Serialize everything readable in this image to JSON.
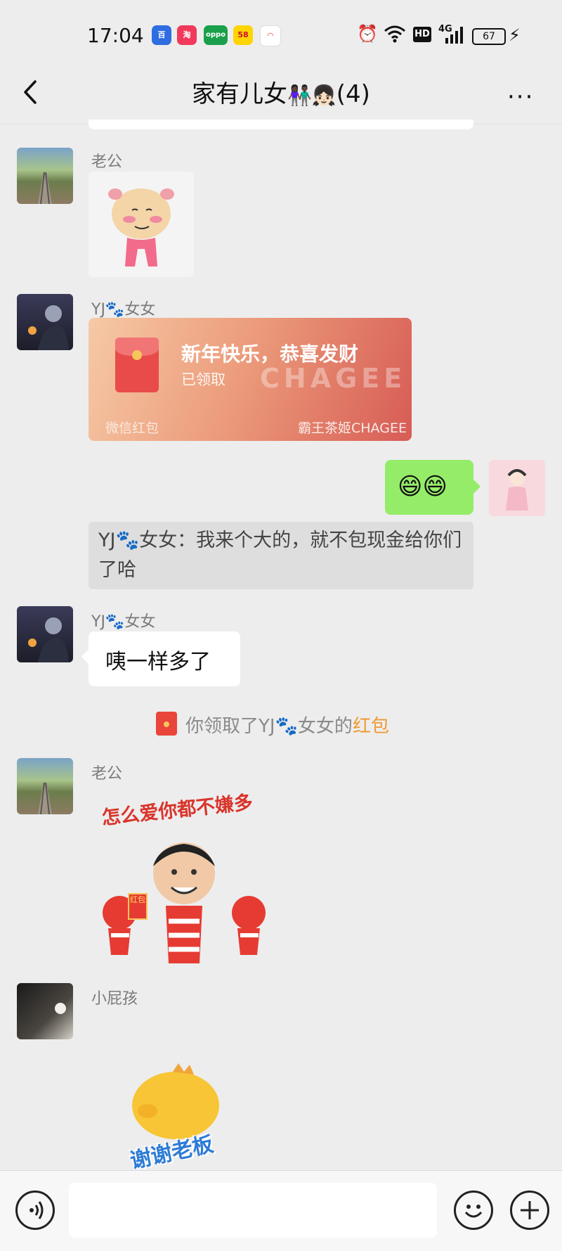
{
  "status_bar": {
    "time": "17:04",
    "apps": [
      {
        "name": "baidu",
        "color": "#2f6de0",
        "label": "百"
      },
      {
        "name": "app2",
        "color": "#f13a5b",
        "label": "淘"
      },
      {
        "name": "oppo",
        "color": "#1aa04a",
        "label": "oppo"
      },
      {
        "name": "58",
        "color": "#ffd400",
        "label": "58"
      },
      {
        "name": "app5",
        "color": "#ffffff",
        "label": "◠"
      }
    ],
    "hd_label": "HD",
    "network_label": "4G",
    "battery": "67"
  },
  "header": {
    "title": "家有儿女👫🏿👧🏻(4)",
    "title_text": "家有儿女",
    "member_count": "(4)",
    "more_label": "···"
  },
  "messages": {
    "m1": {
      "sender": "老公"
    },
    "m2": {
      "sender": "YJ🐾女女",
      "packet_title": "新年快乐，恭喜发财",
      "packet_status": "已领取",
      "packet_brand_big": "CHAGEE",
      "packet_footer_left": "微信红包",
      "packet_footer_right": "霸王茶姬CHAGEE"
    },
    "m3": {
      "emoji": "😄😄"
    },
    "quote": {
      "text": "YJ🐾女女：我来个大的，就不包现金给你们了哈"
    },
    "m4": {
      "sender": "YJ🐾女女",
      "text": "咦一样多了"
    },
    "system": {
      "prefix": "你领取了YJ🐾女女的",
      "link": "红包"
    },
    "m5": {
      "sender": "老公",
      "sticker_caption": "怎么爱你都不嫌多",
      "sticker_tag": "红包"
    },
    "m6": {
      "sender": "小屁孩",
      "sticker_caption": "谢谢老板"
    }
  },
  "colors": {
    "wechat_green": "#95ec69",
    "link_orange": "#f09a37",
    "background": "#ededed"
  }
}
